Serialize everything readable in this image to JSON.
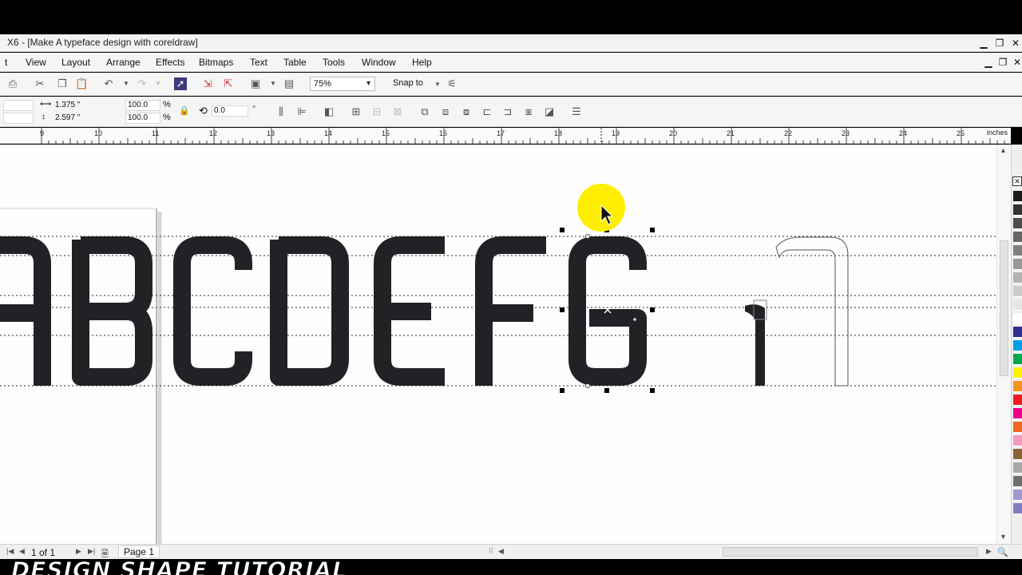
{
  "window": {
    "title": "X6 - [Make A typeface design with coreldraw]",
    "minimize": "▁",
    "restore": "❐",
    "close": "✕"
  },
  "menu": [
    {
      "label": "t"
    },
    {
      "label": "View"
    },
    {
      "label": "Layout"
    },
    {
      "label": "Arrange"
    },
    {
      "label": "Effects"
    },
    {
      "label": "Bitmaps"
    },
    {
      "label": "Text"
    },
    {
      "label": "Table"
    },
    {
      "label": "Tools"
    },
    {
      "label": "Window"
    },
    {
      "label": "Help"
    }
  ],
  "toolbar": {
    "zoom": "75%",
    "snap_to": "Snap to"
  },
  "propbar": {
    "width": "1.375 \"",
    "height": "2.597 \"",
    "scale_x": "100.0",
    "scale_y": "100.0",
    "percent_x": "%",
    "percent_y": "%",
    "rotation": "0.0",
    "degree": "°"
  },
  "ruler": {
    "labels": [
      "9",
      "10",
      "11",
      "12",
      "13",
      "14",
      "15",
      "16",
      "17",
      "18",
      "19",
      "20",
      "21",
      "22",
      "23",
      "24",
      "25"
    ],
    "unit": "inches"
  },
  "status": {
    "page_count": "1 of 1",
    "page_tab": "Page 1"
  },
  "palette": [
    "#1a1a1a",
    "#333333",
    "#4d4d4d",
    "#666666",
    "#808080",
    "#999999",
    "#b3b3b3",
    "#cccccc",
    "#e6e6e6",
    "#ffffff",
    "#2e3192",
    "#00a0e9",
    "#00a650",
    "#fff200",
    "#f7941d",
    "#ed1c24",
    "#ec008c",
    "#f26522",
    "#f49ac1",
    "#8c6239",
    "#a7a9ac",
    "#6d6e71",
    "#9e9ad0",
    "#7f7fbf"
  ],
  "watermark": "DESIGN SHAPE TUTORIAL"
}
